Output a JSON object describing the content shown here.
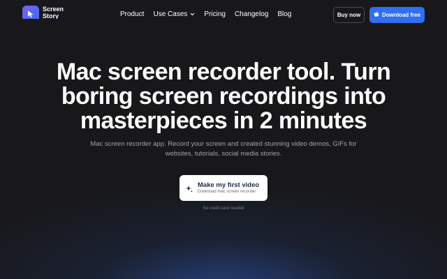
{
  "brand": {
    "name_line1": "Screen",
    "name_line2": "Story"
  },
  "nav": {
    "links": [
      {
        "label": "Product"
      },
      {
        "label": "Use Cases"
      },
      {
        "label": "Pricing"
      },
      {
        "label": "Changelog"
      },
      {
        "label": "Blog"
      }
    ],
    "buy_label": "Buy now",
    "download_label": "Download free"
  },
  "hero": {
    "title": "Mac screen recorder tool. Turn boring screen recordings into masterpieces in 2 minutes",
    "subtitle": "Mac screen recorder app. Record your screen and created stunning video demos, GIFs for websites, tutorials, social media stories.",
    "cta_title": "Make my first video",
    "cta_subtitle": "Download mac screen recorder",
    "note": "No credit card needed"
  },
  "icons": {
    "logo": "cursor-arrow-icon",
    "use_cases_dropdown": "chevron-down-icon",
    "download": "apple-icon",
    "cta": "sparkle-icon"
  },
  "colors": {
    "background": "#18181a",
    "accent": "#2f6ff0",
    "logo_gradient_start": "#7b5cff",
    "logo_gradient_end": "#3b6df5",
    "cta_text": "#1d2a4a"
  }
}
